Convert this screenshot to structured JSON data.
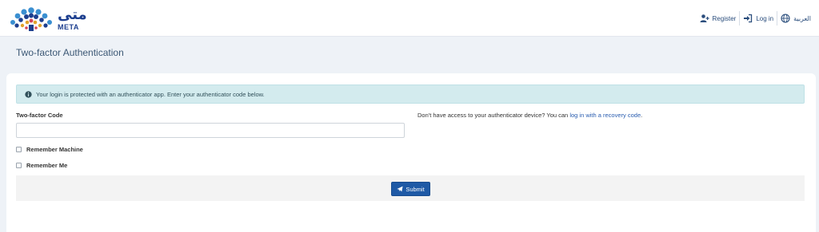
{
  "header": {
    "logo": {
      "name_ar": "متى",
      "name_en": "META"
    },
    "nav": [
      {
        "label": "Register",
        "icon": "user-plus-icon"
      },
      {
        "label": "Log in",
        "icon": "sign-in-icon"
      },
      {
        "label": "العربية",
        "icon": "globe-icon"
      }
    ]
  },
  "page": {
    "title": "Two-factor Authentication"
  },
  "form": {
    "alert_text": "Your login is protected with an authenticator app. Enter your authenticator code below.",
    "code_label": "Two-factor Code",
    "code_value": "",
    "recovery_prefix": "Don't have access to your authenticator device? You can",
    "recovery_link": "log in with a recovery code",
    "recovery_suffix": ".",
    "remember_machine": "Remember Machine",
    "remember_me": "Remember Me",
    "submit_label": "Submit"
  },
  "colors": {
    "brand": "#1d3f8f",
    "primary_button": "#1f5aa6",
    "alert_bg": "#d3ebee",
    "page_bg": "#eef2f7"
  }
}
